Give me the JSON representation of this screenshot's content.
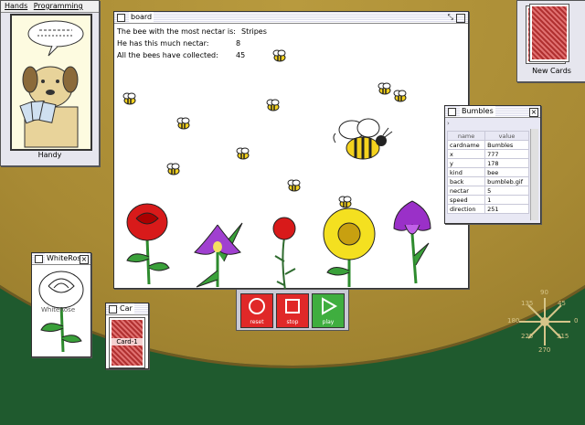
{
  "handy": {
    "menu": [
      "Hands",
      "Programming"
    ],
    "label": "Handy"
  },
  "new_cards": {
    "label": "New Cards"
  },
  "board": {
    "title": "board",
    "lines": [
      {
        "label": "The bee with the most nectar is:",
        "value": "Stripes"
      },
      {
        "label": "He has this much nectar:",
        "value": "8"
      },
      {
        "label": "All the bees have collected:",
        "value": "45"
      }
    ]
  },
  "inspector": {
    "title": "Bumbles",
    "toolbar_icon": "›",
    "columns": [
      "name",
      "value"
    ],
    "rows": [
      {
        "name": "cardname",
        "value": "Bumbles"
      },
      {
        "name": "x",
        "value": "777"
      },
      {
        "name": "y",
        "value": "178"
      },
      {
        "name": "kind",
        "value": "bee"
      },
      {
        "name": "back",
        "value": "bumbleb.gif"
      },
      {
        "name": "nectar",
        "value": "5"
      },
      {
        "name": "speed",
        "value": "1"
      },
      {
        "name": "direction",
        "value": "251"
      }
    ]
  },
  "controls": {
    "reset": "reset",
    "stop": "stop",
    "play": "play",
    "colors": {
      "reset": "#e02828",
      "stop": "#e02828",
      "play": "#3fae3f"
    }
  },
  "white_rose": {
    "title": "WhiteRose",
    "caption": "WhiteRose"
  },
  "card1": {
    "title": "Car",
    "label": "Card-1"
  },
  "compass": {
    "n": "90",
    "ne": "45",
    "e": "0",
    "se": "315",
    "s": "270",
    "sw": "225",
    "w": "180",
    "nw": "135"
  }
}
